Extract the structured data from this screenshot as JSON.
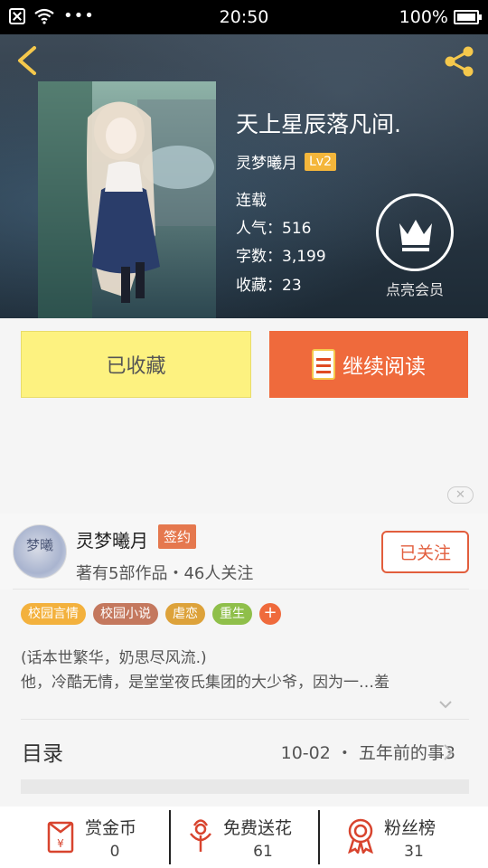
{
  "status_bar": {
    "time": "20:50",
    "battery": "100%"
  },
  "book": {
    "title": "天上星辰落凡间.",
    "author": "灵梦曦月",
    "author_level": "Lv2",
    "status": "连载",
    "popularity": "人气：516",
    "word_count": "字数：3,199",
    "favorites": "收藏：23"
  },
  "vip": {
    "label": "点亮会员"
  },
  "actions": {
    "collected_label": "已收藏",
    "read_label": "继续阅读"
  },
  "close_chip": "✕",
  "author_card": {
    "name": "灵梦曦月",
    "badge": "签约",
    "meta": "著有5部作品・46人关注",
    "follow_label": "已关注",
    "avatar_text": "梦曦"
  },
  "tags": [
    {
      "label": "校园言情",
      "color": "#f3b13d"
    },
    {
      "label": "校园小说",
      "color": "#c4785e"
    },
    {
      "label": "虐恋",
      "color": "#dda23a"
    },
    {
      "label": "重生",
      "color": "#8fbf4a"
    }
  ],
  "tag_add": "+",
  "description": {
    "line1": "(话本世繁华，奶思尽风流.)",
    "line2": "他，冷酷无情，是堂堂夜氏集团的大少爷，因为一…羞"
  },
  "catalog": {
    "label": "目录",
    "latest": "10-02 ・ 五年前的事3"
  },
  "bottom_actions": [
    {
      "label": "赏金币",
      "count": "0",
      "icon": "red-envelope-yen-icon"
    },
    {
      "label": "免费送花",
      "count": "61",
      "icon": "flower-icon"
    },
    {
      "label": "粉丝榜",
      "count": "31",
      "icon": "award-medal-icon"
    }
  ],
  "colors": {
    "accent": "#ef6a3c",
    "collected_bg": "#fdf280",
    "follow": "#e25e3d"
  }
}
